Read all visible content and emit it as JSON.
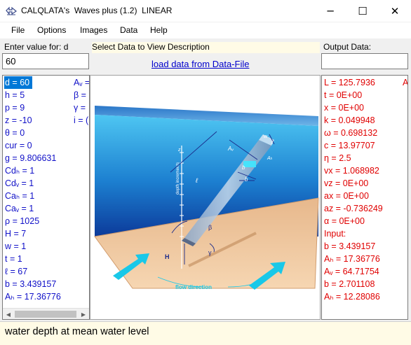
{
  "window": {
    "title": "CALQLATA's  Waves plus (1.2)  LINEAR",
    "minimize_glyph": "─",
    "maximize_glyph": "☐",
    "close_glyph": "✕"
  },
  "menu": [
    "File",
    "Options",
    "Images",
    "Data",
    "Help"
  ],
  "labels": {
    "enter_value": "Enter value for: d",
    "select_data": "Select Data to View Description",
    "output_data": "Output Data:",
    "load_link": "load data from Data-File"
  },
  "input": {
    "value": "60"
  },
  "input_list": [
    "d = 60",
    "h = 5",
    "p = 9",
    "z = -10",
    "θ = 0",
    "cur = 0",
    "g = 9.806631",
    "Cdₕ = 1",
    "Cdᵥ = 1",
    "Caₕ = 1",
    "Caᵥ = 1",
    "ρ = 1025",
    "H = 7",
    "w = 1",
    "t = 1",
    "ℓ = 67",
    "b = 3.439157",
    "Aₕ = 17.36776"
  ],
  "input_list_col2": [
    "Aᵥ =",
    "β =",
    "γ =",
    "i = ("
  ],
  "output_list": [
    "L = 125.7936",
    "t = 0E+00",
    "x = 0E+00",
    "k = 0.049948",
    "ω = 0.698132",
    "c = 13.97707",
    "η = 2.5",
    "vx = 1.068982",
    "vz = 0E+00",
    "ax = 0E+00",
    "az = -0.736249",
    "α = 0E+00",
    "Input:",
    "b = 3.439157",
    "Aₕ = 17.36776",
    "Aᵥ = 64.71754",
    "b = 2.701108",
    "Aₕ = 12.28086"
  ],
  "output_overflow": "A",
  "diagram": {
    "labels": {
      "w": "w",
      "t": "t",
      "av": "Aᵥ",
      "ah": "Aₕ",
      "b1": "b",
      "b2": "b",
      "l": "ℓ",
      "depth": "depth increments",
      "z": "z",
      "beta": "β",
      "gamma": "γ",
      "h": "H",
      "flow": "flow direction"
    }
  },
  "description": "water depth at mean water level",
  "colors": {
    "selection": "#0078d7",
    "input_text": "#1010c8",
    "output_text": "#e00000",
    "link": "#0000cc",
    "sea": "#1a8fd6",
    "seabed": "#f0c89a",
    "flow_arrow": "#19c8e8"
  }
}
